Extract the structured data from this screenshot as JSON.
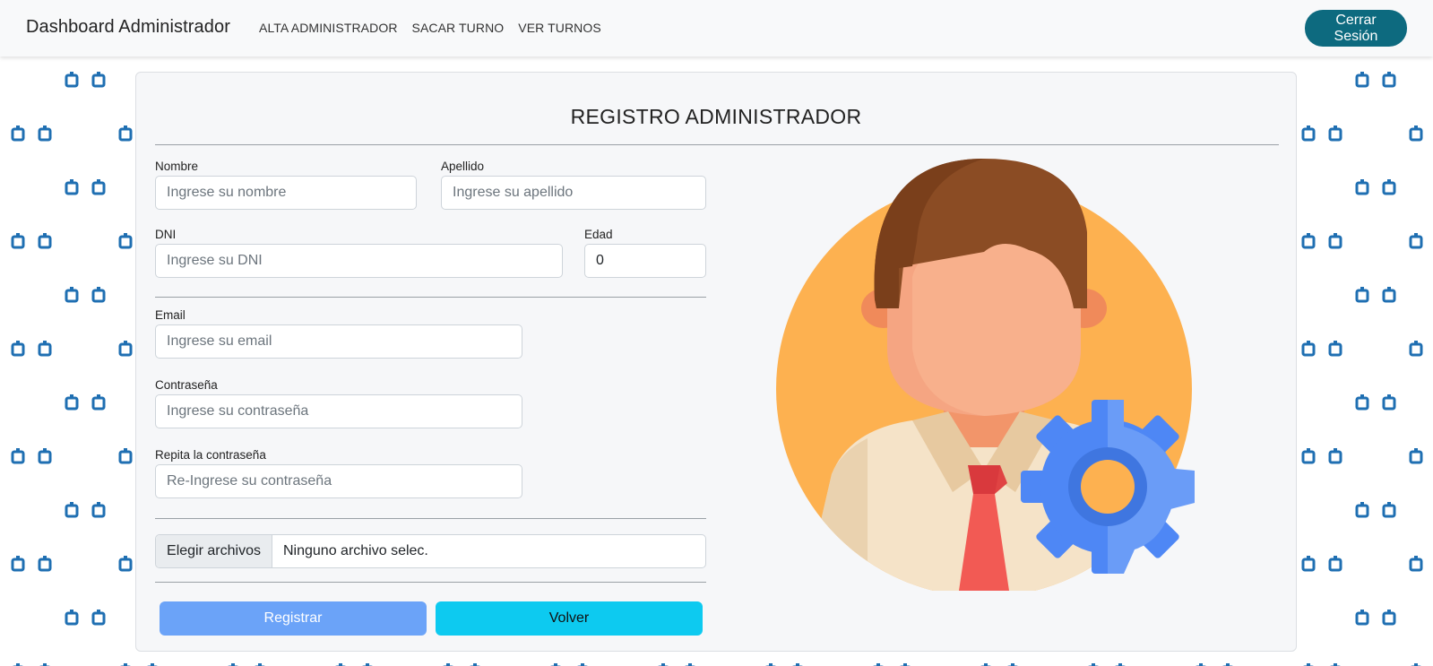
{
  "navbar": {
    "brand": "Dashboard Administrador",
    "links": [
      "ALTA ADMINISTRADOR",
      "SACAR TURNO",
      "VER TURNOS"
    ],
    "logout_label": "Cerrar Sesión",
    "logout_color": "#0d6a7f"
  },
  "form": {
    "title": "REGISTRO ADMINISTRADOR",
    "nombre": {
      "label": "Nombre",
      "placeholder": "Ingrese su nombre",
      "value": ""
    },
    "apellido": {
      "label": "Apellido",
      "placeholder": "Ingrese su apellido",
      "value": ""
    },
    "dni": {
      "label": "DNI",
      "placeholder": "Ingrese su DNI",
      "value": ""
    },
    "edad": {
      "label": "Edad",
      "value": "0"
    },
    "email": {
      "label": "Email",
      "placeholder": "Ingrese su email",
      "value": ""
    },
    "password": {
      "label": "Contraseña",
      "placeholder": "Ingrese su contraseña",
      "value": ""
    },
    "password_repeat": {
      "label": "Repita la contraseña",
      "placeholder": "Re-Ingrese su contraseña",
      "value": ""
    },
    "file": {
      "button_label": "Elegir archivos",
      "status": "Ninguno archivo selec."
    },
    "register_label": "Registrar",
    "back_label": "Volver"
  },
  "illustration": {
    "name": "admin-avatar-gear-icon"
  },
  "colors": {
    "accent_register": "#6ba3f8",
    "accent_back": "#0dcaf0",
    "background_pattern": "#1f6fb2"
  }
}
